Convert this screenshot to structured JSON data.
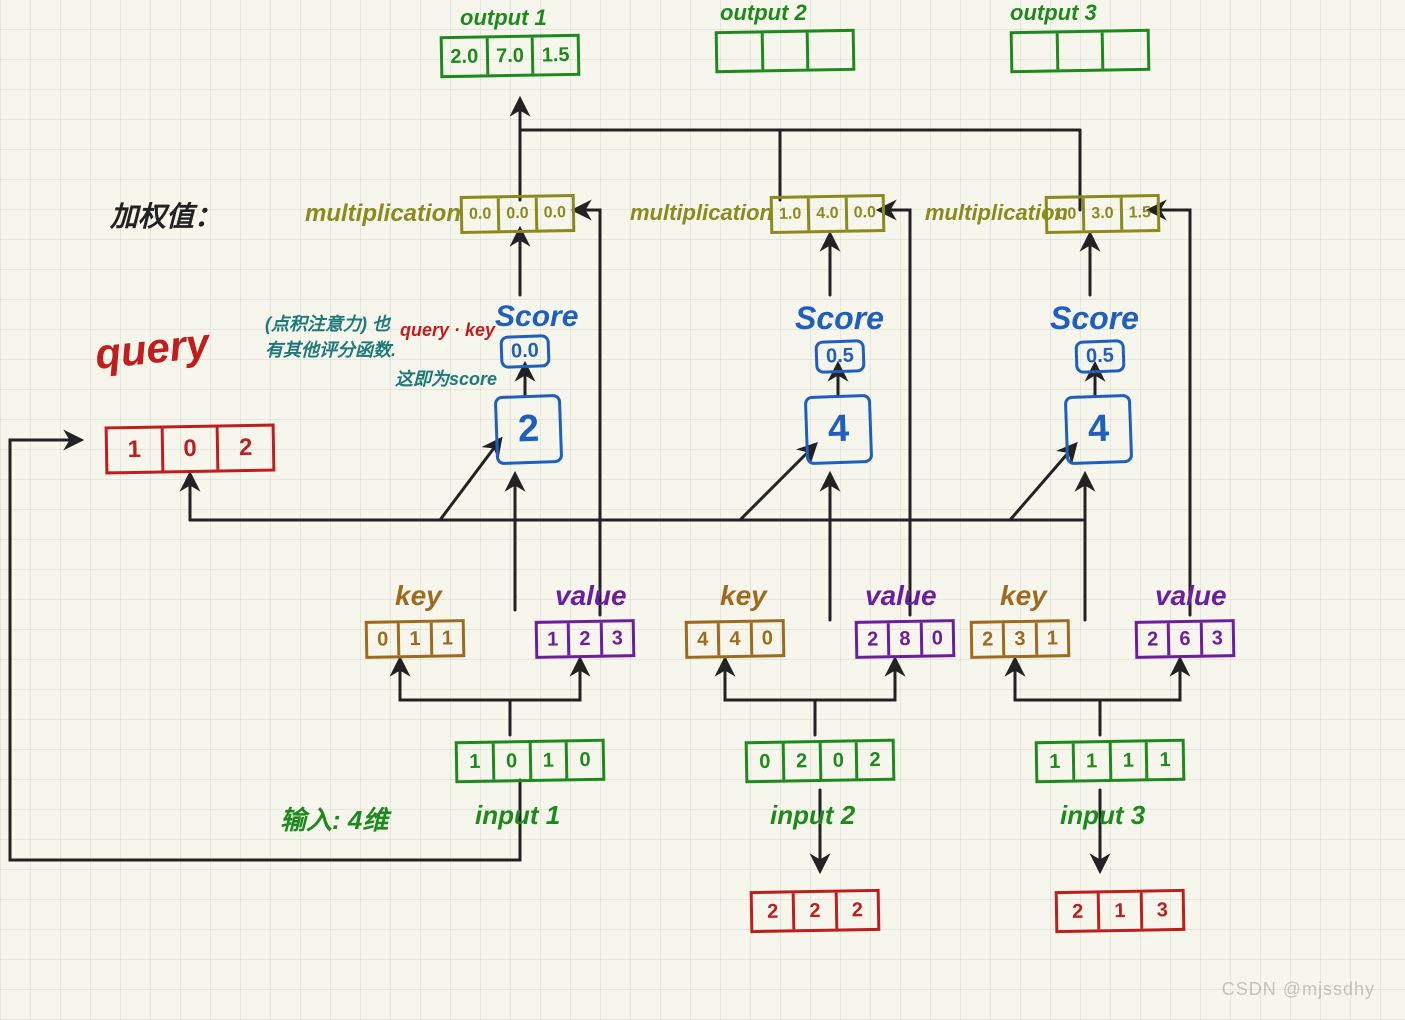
{
  "watermark": "CSDN @mjssdhy",
  "top": {
    "output1": {
      "label": "output 1",
      "cells": [
        "2.0",
        "7.0",
        "1.5"
      ]
    },
    "output2": {
      "label": "output 2",
      "cells": [
        "",
        "",
        ""
      ]
    },
    "output3": {
      "label": "output 3",
      "cells": [
        "",
        "",
        ""
      ]
    }
  },
  "weighted_label": "加权值：",
  "multiplication_label": "multiplication",
  "mult": {
    "m1": [
      "0.0",
      "0.0",
      "0.0"
    ],
    "m2": [
      "1.0",
      "4.0",
      "0.0"
    ],
    "m3": [
      "1.0",
      "3.0",
      "1.5"
    ]
  },
  "score_label": "Score",
  "score_note_cn": "(点积注意力) 也有其他评分函数.",
  "score_note_formula": "query · key",
  "score_note_result": "这即为score",
  "scores": {
    "s1": {
      "softmax": "0.0",
      "raw": "2"
    },
    "s2": {
      "softmax": "0.5",
      "raw": "4"
    },
    "s3": {
      "softmax": "0.5",
      "raw": "4"
    }
  },
  "query_label": "query",
  "query": [
    "1",
    "0",
    "2"
  ],
  "kv_labels": {
    "key": "key",
    "value": "value"
  },
  "kv": {
    "k1": [
      "0",
      "1",
      "1"
    ],
    "v1": [
      "1",
      "2",
      "3"
    ],
    "k2": [
      "4",
      "4",
      "0"
    ],
    "v2": [
      "2",
      "8",
      "0"
    ],
    "k3": [
      "2",
      "3",
      "1"
    ],
    "v3": [
      "2",
      "6",
      "3"
    ]
  },
  "input_prefix": "输入: 4维",
  "inputs": {
    "i1": {
      "label": "input 1",
      "cells": [
        "1",
        "0",
        "1",
        "0"
      ]
    },
    "i2": {
      "label": "input 2",
      "cells": [
        "0",
        "2",
        "0",
        "2"
      ]
    },
    "i3": {
      "label": "input 3",
      "cells": [
        "1",
        "1",
        "1",
        "1"
      ]
    }
  },
  "bottom_vectors": {
    "b2": [
      "2",
      "2",
      "2"
    ],
    "b3": [
      "2",
      "1",
      "3"
    ]
  }
}
